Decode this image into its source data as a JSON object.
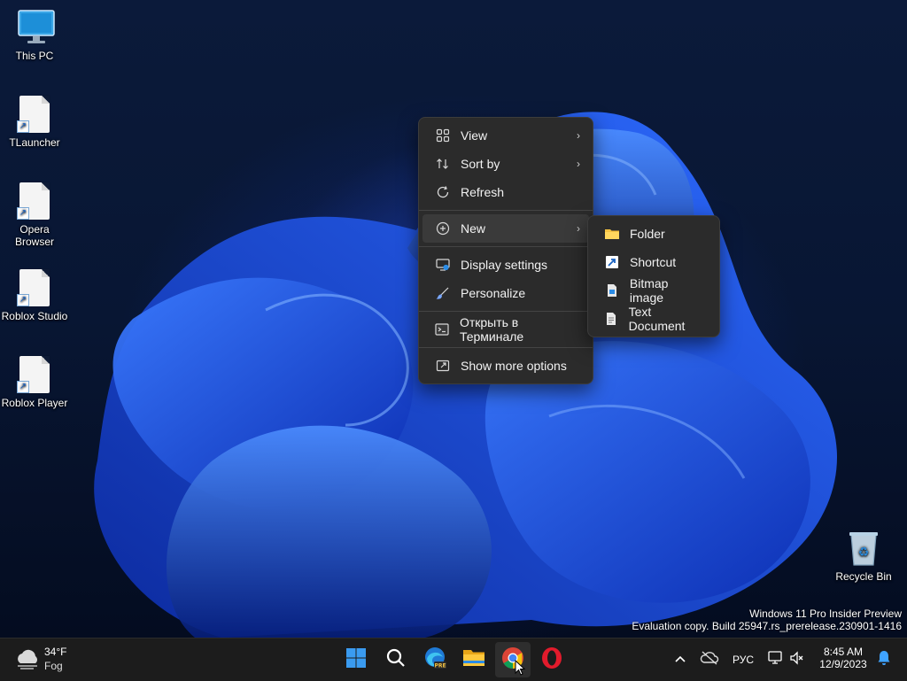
{
  "desktop": {
    "icons": [
      {
        "label": "This PC"
      },
      {
        "label": "TLauncher"
      },
      {
        "label": "Opera Browser"
      },
      {
        "label": "Roblox Studio"
      },
      {
        "label": "Roblox Player"
      },
      {
        "label": "Recycle Bin"
      }
    ]
  },
  "context_menu": {
    "items": [
      {
        "label": "View",
        "icon": "grid-view-icon",
        "has_submenu": true
      },
      {
        "label": "Sort by",
        "icon": "sort-arrows-icon",
        "has_submenu": true
      },
      {
        "label": "Refresh",
        "icon": "refresh-icon",
        "has_submenu": false
      },
      {
        "label": "New",
        "icon": "plus-circle-icon",
        "has_submenu": true,
        "highlighted": true
      },
      {
        "label": "Display settings",
        "icon": "display-settings-icon",
        "has_submenu": false
      },
      {
        "label": "Personalize",
        "icon": "brush-icon",
        "has_submenu": false
      },
      {
        "label": "Открыть в Терминале",
        "icon": "terminal-icon",
        "has_submenu": false
      },
      {
        "label": "Show more options",
        "icon": "show-more-icon",
        "has_submenu": false
      }
    ]
  },
  "submenu_new": {
    "items": [
      {
        "label": "Folder",
        "icon": "folder-icon"
      },
      {
        "label": "Shortcut",
        "icon": "shortcut-icon"
      },
      {
        "label": "Bitmap image",
        "icon": "bitmap-icon"
      },
      {
        "label": "Text Document",
        "icon": "text-document-icon"
      }
    ]
  },
  "watermark": {
    "line1": "Windows 11 Pro Insider Preview",
    "line2": "Evaluation copy. Build 25947.rs_prerelease.230901-1416"
  },
  "taskbar": {
    "weather": {
      "temp": "34°F",
      "condition": "Fog"
    },
    "apps": [
      "start-button",
      "search-button",
      "edge-beta-button",
      "file-explorer-button",
      "chrome-button",
      "opera-button"
    ],
    "tray": {
      "language": "РУС",
      "time": "8:45 AM",
      "date": "12/9/2023"
    }
  },
  "colors": {
    "menu_bg": "#2b2b2b",
    "menu_hover": "#3a3a3a",
    "taskbar_bg": "#1c1c1c",
    "accent_blue": "#1e63ff"
  }
}
